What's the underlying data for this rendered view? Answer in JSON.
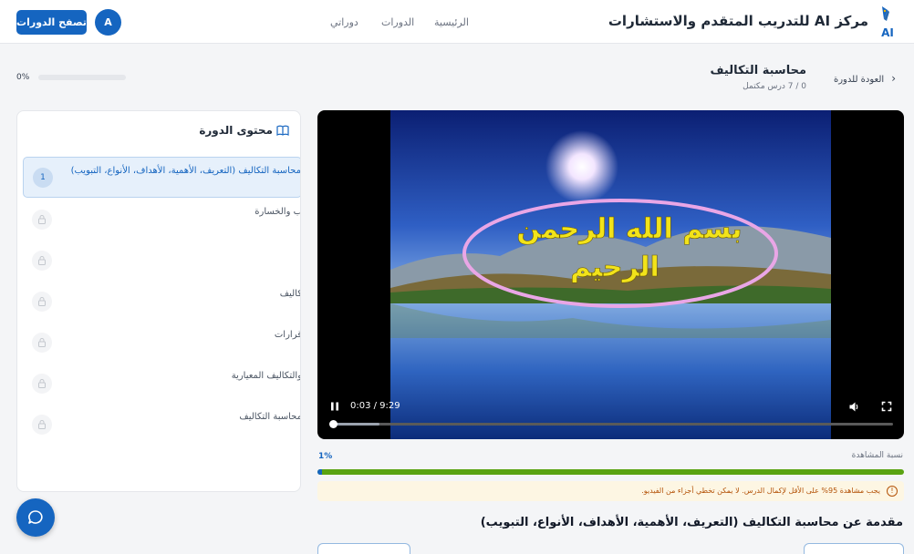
{
  "header": {
    "brand": "مركز AI للتدريب المتقدم والاستشارات",
    "logo_text": "AI",
    "nav": [
      "الرئيسية",
      "الدورات",
      "دوراتي"
    ],
    "browse_button": "تصفح الدورات",
    "avatar_initial": "A"
  },
  "course": {
    "back_label": "العودة للدورة",
    "title": "محاسبة التكاليف",
    "progress_text": "0 / 7 درس مكتمل",
    "progress_percent_label": "0%",
    "progress_value": 0
  },
  "sidebar": {
    "title": "محتوى الدورة",
    "lessons": [
      {
        "number": "1",
        "label": "محاسبة التكاليف (التعريف، الأهمية، الأهداف، الأنواع، التبويب)",
        "state": "active"
      },
      {
        "number": "",
        "label": "ب والخسارة",
        "state": "locked"
      },
      {
        "number": "",
        "label": "",
        "state": "locked"
      },
      {
        "number": "",
        "label": "كاليف",
        "state": "locked"
      },
      {
        "number": "",
        "label": "قرارات",
        "state": "locked"
      },
      {
        "number": "",
        "label": "والتكاليف المعيارية",
        "state": "locked"
      },
      {
        "number": "",
        "label": "محاسبة التكاليف",
        "state": "locked"
      }
    ]
  },
  "video": {
    "overlay_line1": "بسم الله الرحمن",
    "overlay_line2": "الرحيم",
    "time": "0:03 / 9:29",
    "played_fraction": 0.005,
    "buffered_fraction": 0.088
  },
  "watch": {
    "label": "نسبة المشاهدة",
    "percent_label": "1%",
    "fill_fraction": 1.0,
    "notice": "يجب مشاهدة 95% على الأقل لإكمال الدرس. لا يمكن تخطي أجزاء من الفيديو."
  },
  "lesson": {
    "heading": "مقدمة عن محاسبة التكاليف (التعريف، الأهمية، الأهداف، الأنواع، التبويب)"
  },
  "colors": {
    "primary": "#1565c0",
    "progress_green": "#5aa312",
    "notice_bg": "#fdf6e3",
    "notice_text": "#b45309"
  },
  "icons": [
    "logo-pen-icon",
    "chevron-left-icon",
    "book-open-icon",
    "lock-icon",
    "pause-icon",
    "volume-icon",
    "fullscreen-icon",
    "info-icon",
    "chat-icon"
  ]
}
